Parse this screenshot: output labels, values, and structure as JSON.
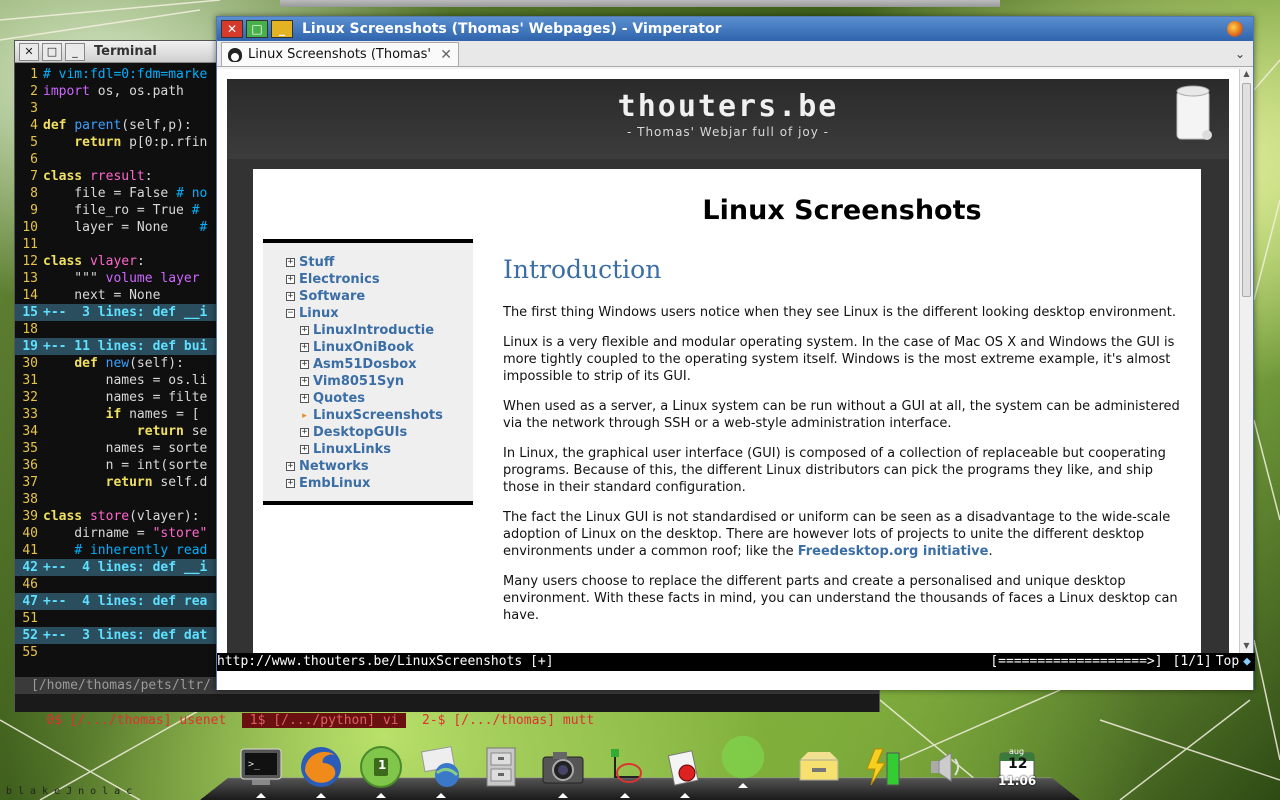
{
  "terminal": {
    "title": "Terminal",
    "buttons": {
      "close": "✕",
      "maximize": "□",
      "minimize": "_"
    },
    "lines": [
      {
        "n": "1",
        "parts": [
          [
            "cmt",
            "# vim:fdl=0:fdm=marke"
          ]
        ]
      },
      {
        "n": "2",
        "parts": [
          [
            "kw",
            "import"
          ],
          [
            "",
            " os, os.path"
          ]
        ]
      },
      {
        "n": "3",
        "parts": []
      },
      {
        "n": "4",
        "parts": [
          [
            "k",
            "def"
          ],
          [
            "",
            " "
          ],
          [
            "c",
            "parent"
          ],
          [
            "",
            "(self,p):"
          ]
        ]
      },
      {
        "n": "5",
        "parts": [
          [
            "",
            "    "
          ],
          [
            "k",
            "return"
          ],
          [
            "",
            " p[0:p.rfin"
          ]
        ]
      },
      {
        "n": "6",
        "parts": []
      },
      {
        "n": "7",
        "parts": [
          [
            "k",
            "class"
          ],
          [
            "",
            " "
          ],
          [
            "s",
            "rresult"
          ],
          [
            "",
            ":"
          ]
        ]
      },
      {
        "n": "8",
        "parts": [
          [
            "",
            "    file = False "
          ],
          [
            "cmt",
            "# no"
          ]
        ]
      },
      {
        "n": "9",
        "parts": [
          [
            "",
            "    file_ro = True "
          ],
          [
            "cmt",
            "#"
          ]
        ]
      },
      {
        "n": "10",
        "parts": [
          [
            "",
            "    layer = None    "
          ],
          [
            "cmt",
            "#"
          ]
        ]
      },
      {
        "n": "11",
        "parts": []
      },
      {
        "n": "12",
        "parts": [
          [
            "k",
            "class"
          ],
          [
            "",
            " "
          ],
          [
            "s",
            "vlayer"
          ],
          [
            "",
            ":"
          ]
        ]
      },
      {
        "n": "13",
        "parts": [
          [
            "",
            "    \"\"\" "
          ],
          [
            "kw",
            "volume layer"
          ]
        ]
      },
      {
        "n": "14",
        "parts": [
          [
            "",
            "    next = None"
          ]
        ]
      },
      {
        "n": "15",
        "fold": true,
        "parts": [
          [
            "",
            "+--  3 lines: def __i"
          ]
        ]
      },
      {
        "n": "18",
        "parts": []
      },
      {
        "n": "19",
        "fold": true,
        "parts": [
          [
            "",
            "+-- 11 lines: def bui"
          ]
        ]
      },
      {
        "n": "30",
        "parts": [
          [
            "",
            "    "
          ],
          [
            "k",
            "def"
          ],
          [
            "",
            " "
          ],
          [
            "c",
            "new"
          ],
          [
            "",
            "(self):"
          ]
        ]
      },
      {
        "n": "31",
        "parts": [
          [
            "",
            "        names = os.li"
          ]
        ]
      },
      {
        "n": "32",
        "parts": [
          [
            "",
            "        names = filte"
          ]
        ]
      },
      {
        "n": "33",
        "parts": [
          [
            "",
            "        "
          ],
          [
            "k",
            "if"
          ],
          [
            "",
            " names = ["
          ]
        ]
      },
      {
        "n": "34",
        "parts": [
          [
            "",
            "            "
          ],
          [
            "k",
            "return"
          ],
          [
            "",
            " se"
          ]
        ]
      },
      {
        "n": "35",
        "parts": [
          [
            "",
            "        names = sorte"
          ]
        ]
      },
      {
        "n": "36",
        "parts": [
          [
            "",
            "        n = int(sorte"
          ]
        ]
      },
      {
        "n": "37",
        "parts": [
          [
            "",
            "        "
          ],
          [
            "k",
            "return"
          ],
          [
            "",
            " self.d"
          ]
        ]
      },
      {
        "n": "38",
        "parts": []
      },
      {
        "n": "39",
        "parts": [
          [
            "k",
            "class"
          ],
          [
            "",
            " "
          ],
          [
            "s",
            "store"
          ],
          [
            "",
            "(vlayer):"
          ]
        ]
      },
      {
        "n": "40",
        "parts": [
          [
            "",
            "    dirname = "
          ],
          [
            "s",
            "\"store\""
          ]
        ]
      },
      {
        "n": "41",
        "parts": [
          [
            "",
            "    "
          ],
          [
            "cmt",
            "# inherently read"
          ]
        ]
      },
      {
        "n": "42",
        "fold": true,
        "parts": [
          [
            "",
            "+--  4 lines: def __i"
          ]
        ]
      },
      {
        "n": "46",
        "parts": []
      },
      {
        "n": "47",
        "fold": true,
        "parts": [
          [
            "",
            "+--  4 lines: def rea"
          ]
        ]
      },
      {
        "n": "51",
        "parts": []
      },
      {
        "n": "52",
        "fold": true,
        "parts": [
          [
            "",
            "+--  3 lines: def dat"
          ]
        ]
      },
      {
        "n": "55",
        "parts": []
      }
    ],
    "status": "[/home/thomas/pets/ltr/",
    "tabs": [
      "0$ [/.../thomas] usenet  ",
      " 1$ [/.../python] vi ",
      "  2-$ [/.../thomas] mutt"
    ]
  },
  "browser": {
    "window_title": "Linux Screenshots (Thomas' Webpages) - Vimperator",
    "tab_label": "Linux Screenshots (Thomas' W...",
    "tab_close": "✕",
    "tab_menu": "⌄",
    "site": {
      "title": "thouters.be",
      "tagline": "- Thomas' Webjar full of joy -",
      "page_title": "Linux Screenshots",
      "nav": [
        {
          "label": "Stuff",
          "level": 1,
          "marker": "+"
        },
        {
          "label": "Electronics",
          "level": 1,
          "marker": "+"
        },
        {
          "label": "Software",
          "level": 1,
          "marker": "+"
        },
        {
          "label": "Linux",
          "level": 1,
          "marker": "−"
        },
        {
          "label": "LinuxIntroductie",
          "level": 2,
          "marker": "+"
        },
        {
          "label": "LinuxOniBook",
          "level": 2,
          "marker": "+"
        },
        {
          "label": "Asm51Dosbox",
          "level": 2,
          "marker": "+"
        },
        {
          "label": "Vim8051Syn",
          "level": 2,
          "marker": "+"
        },
        {
          "label": "Quotes",
          "level": 2,
          "marker": "+"
        },
        {
          "label": "LinuxScreenshots",
          "level": 2,
          "marker": "arrow"
        },
        {
          "label": "DesktopGUIs",
          "level": 2,
          "marker": "+"
        },
        {
          "label": "LinuxLinks",
          "level": 2,
          "marker": "+"
        },
        {
          "label": "Networks",
          "level": 1,
          "marker": "+"
        },
        {
          "label": "EmbLinux",
          "level": 1,
          "marker": "+"
        }
      ],
      "article": {
        "heading": "Introduction",
        "p1": "The first thing Windows users notice when they see Linux is the different looking desktop environment.",
        "p2": "Linux is a very flexible and modular operating system. In the case of Mac OS X and Windows the GUI is more tightly coupled to the operating system itself. Windows is the most extreme example, it's almost impossible to strip of its GUI.",
        "p3": "When used as a server, a Linux system can be run without a GUI at all, the system can be administered via the network through SSH or a web-style administration interface.",
        "p4": "In Linux, the graphical user interface (GUI) is composed of a collection of replaceable but cooperating programs. Because of this, the different Linux distributors can pick the programs they like, and ship those in their standard configuration.",
        "p5_before": "The fact the Linux GUI is not standardised or uniform can be seen as a disadvantage to the wide-scale adoption of Linux on the desktop. There are however lots of projects to unite the different desktop environments under a common roof; like the ",
        "p5_link": "Freedesktop.org initiative",
        "p5_after": ".",
        "p6": "Many users choose to replace the different parts and create a personalised and unique desktop environment. With these facts in mind, you can understand the thousands of faces a Linux desktop can have."
      }
    },
    "status": {
      "url": "http://www.thouters.be/LinuxScreenshots [+]",
      "progress": "[===================>]",
      "tab_count": "[1/1]",
      "position": "Top"
    }
  },
  "dock": {
    "clock_month": "aug",
    "clock_day": "12",
    "clock_time": "11:06",
    "workspace_badge": "1"
  },
  "watermark": "blakeJnolac"
}
